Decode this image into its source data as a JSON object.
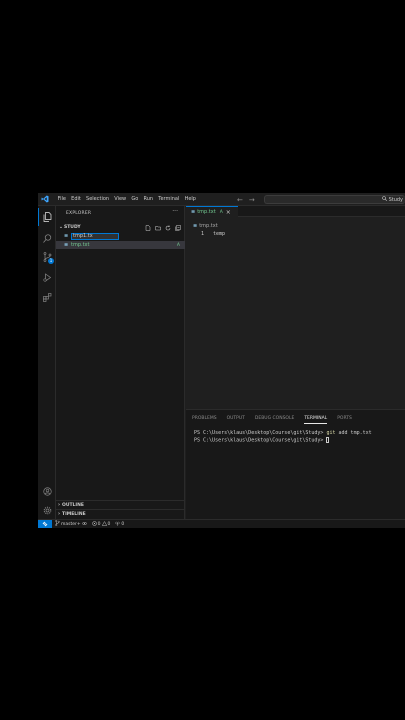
{
  "colors": {
    "accent": "#0078d4",
    "added": "#73c991",
    "bg": "#1f1f1f",
    "sidebar": "#181818"
  },
  "menu": [
    "File",
    "Edit",
    "Selection",
    "View",
    "Go",
    "Run",
    "Terminal",
    "Help"
  ],
  "command_center": {
    "text": "Study",
    "icon": "search-icon"
  },
  "explorer": {
    "title": "EXPLORER",
    "more": "···",
    "folder": "STUDY",
    "rename_value": "tmp1.tx",
    "files": [
      {
        "name": "tmp.txt",
        "status": "A"
      }
    ],
    "outline": "OUTLINE",
    "timeline": "TIMELINE"
  },
  "activity": {
    "scm_badge": "1"
  },
  "editor": {
    "tab": {
      "name": "tmp.txt",
      "status": "A",
      "close": "×"
    },
    "breadcrumb": "tmp.txt",
    "lines": [
      {
        "num": "1",
        "text": "temp"
      }
    ]
  },
  "panel": {
    "tabs": [
      "PROBLEMS",
      "OUTPUT",
      "DEBUG CONSOLE",
      "TERMINAL",
      "PORTS"
    ],
    "active_tab": "TERMINAL",
    "terminal": {
      "line1_prompt": "PS C:\\Users\\klaus\\Desktop\\Course\\git\\Study>",
      "line1_cmd": "git",
      "line1_args": "add tmp.txt",
      "line2_prompt": "PS C:\\Users\\klaus\\Desktop\\Course\\git\\Study>"
    }
  },
  "statusbar": {
    "branch": "master+",
    "errors": "0",
    "warnings": "0",
    "ports": "0"
  }
}
